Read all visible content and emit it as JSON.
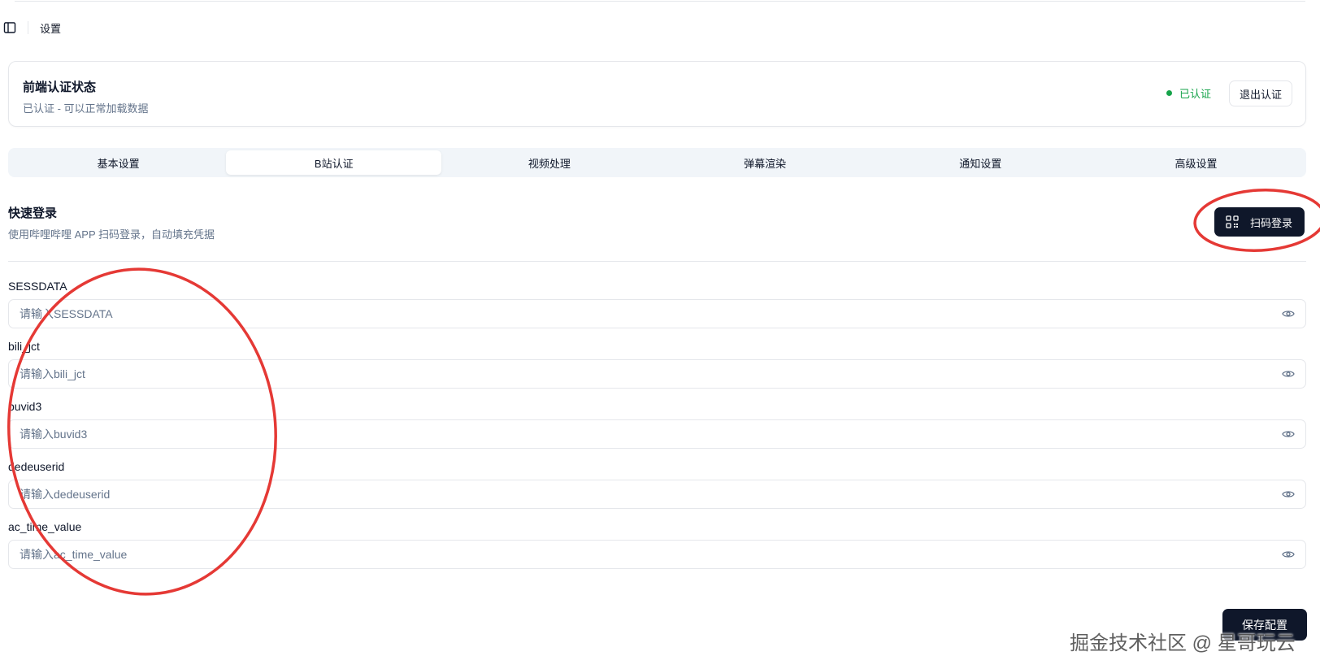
{
  "header": {
    "breadcrumb": "设置",
    "toggle_icon": "sidebar-toggle-icon"
  },
  "auth": {
    "title": "前端认证状态",
    "description": "已认证 - 可以正常加载数据",
    "status_label": "已认证",
    "status_color": "#16a34a",
    "logout_label": "退出认证"
  },
  "tabs": [
    {
      "label": "基本设置",
      "active": false
    },
    {
      "label": "B站认证",
      "active": true
    },
    {
      "label": "视频处理",
      "active": false
    },
    {
      "label": "弹幕渲染",
      "active": false
    },
    {
      "label": "通知设置",
      "active": false
    },
    {
      "label": "高级设置",
      "active": false
    }
  ],
  "quick_login": {
    "title": "快速登录",
    "description": "使用哔哩哔哩 APP 扫码登录，自动填充凭据",
    "button_label": "扫码登录",
    "button_icon": "qr-code-icon"
  },
  "fields": [
    {
      "label": "SESSDATA",
      "placeholder": "请输入SESSDATA",
      "value": ""
    },
    {
      "label": "bili_jct",
      "placeholder": "请输入bili_jct",
      "value": ""
    },
    {
      "label": "buvid3",
      "placeholder": "请输入buvid3",
      "value": ""
    },
    {
      "label": "dedeuserid",
      "placeholder": "请输入dedeuserid",
      "value": ""
    },
    {
      "label": "ac_time_value",
      "placeholder": "请输入ac_time_value",
      "value": ""
    }
  ],
  "save_label": "保存配置",
  "watermark": "掘金技术社区 @ 星哥玩云",
  "colors": {
    "primary": "#0f172a",
    "success": "#16a34a",
    "annotation": "#e53935"
  }
}
